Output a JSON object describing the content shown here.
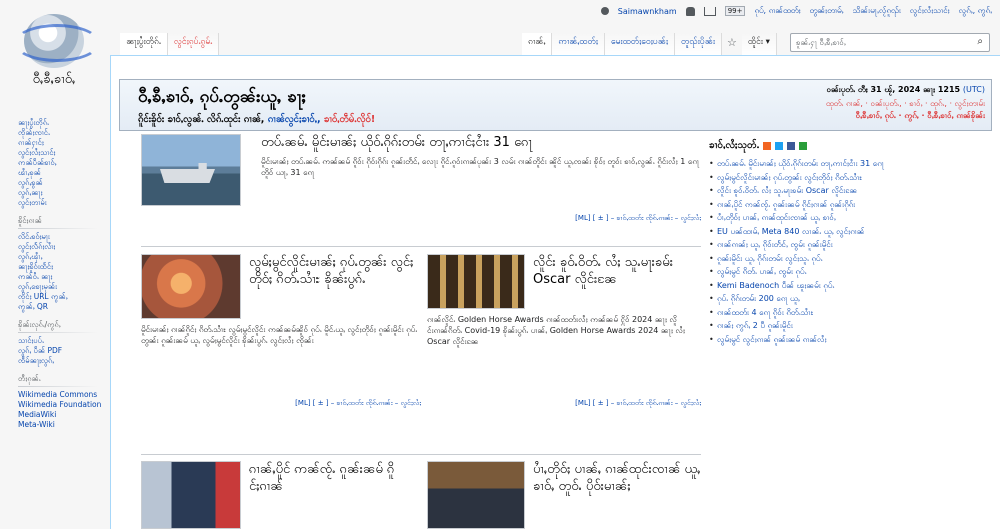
{
  "personal": {
    "username": "Saimawnkham",
    "notifications_count": "99+",
    "links": [
      "ၵုပ်, ၵၢၼ်ထတ်ႈ",
      "တွၼ်ႈတၢမ်ႇ",
      "သိၼ်းမႃႇလႂ်ၵူၺ်း",
      "လွင်ႈလႆႈသၢင်ႈ",
      "လွၵ်ႇ, ဢွၵ်ႇ"
    ]
  },
  "logo": {
    "wordmark": "ဝီႇၶီႇၶၢဝ်ႇ"
  },
  "tabs_left": [
    {
      "label": "ၼႃႈပွႆးတိုၵ်ႉ",
      "selected": true
    },
    {
      "label": "လွင်ႈၵုပ်ႉၵွမ်ႉ",
      "selected": false
    }
  ],
  "tabs_right": [
    {
      "label": "ၵၢၼ်ႇ",
      "selected": true
    },
    {
      "label": "ဢၢၼ်ႇထတ်ႈ",
      "selected": false
    },
    {
      "label": "မေးထတ်ႈဝေႈပၼ်ႈ",
      "selected": false
    },
    {
      "label": "တူၺ်းပိုၼ်း",
      "selected": false
    }
  ],
  "more_tab": "ထိူင်း ▾",
  "search": {
    "placeholder": "ၶူၼ်ႉႁႃ ဝီႇၶီႇၶၢဝ်ႇ"
  },
  "sidebar": {
    "sections": [
      {
        "head": "",
        "items": [
          "ၼႃႈပွႆးတိုၵ်ႉ",
          "ၸိုၼ်ႈၸၢင်ႉ",
          "ၵၢၼ်ႁၢင်ႈ",
          "လွင်ႈလႆႈသၢင်ႈ",
          "ဢၼ်ပဵၼ်ၶၢဝ်ႇ",
          "ၽၢႆႇၶုၼ်",
          "လွၵ်ႇၶွၼ်",
          "လွၵ်ႇၼႃႈ",
          "လွင်ႈတၢမ်း"
        ]
      },
      {
        "head": "ၶိူင်ႈၵၢၼ်",
        "items": [
          "လိင်ႉၶဝ်ႈမႃး",
          "လွင်ႈလႅၵ်ႈလၢႆႈ",
          "လွၵ်ႇၾၢႆႇ",
          "ၼႃႈၶိူဝ်းထႅင်ႈ",
          "ဢၼ်ဝႆႉ ၼႃႈ",
          "လွၵ်ႇၶေႃႈမုၼ်း",
          "ၸိုင်ႈ URL ဢွၼ်ႇ",
          "ဢွၼ်ႇ QR"
        ]
      },
      {
        "head": "ၶိုၼ်းလုၵ်ႉ/ဢွၵ်ႇ",
        "items": [
          "သၢင်ႈပပ်ႉ",
          "လွၵ်ႇ ပဵၼ် PDF",
          "ၸဵမ်ၼႃႈလွၵ်ႇ"
        ]
      },
      {
        "head": "တီႈၵုၼ်ႉ",
        "items": [
          "Wikimedia Commons",
          "Wikimedia Foundation",
          "MediaWiki",
          "Meta-Wiki"
        ]
      }
    ]
  },
  "banner": {
    "title": "ဝီႇၶီႇၶၢဝ်ႇ ၵုပ်ႉတွၼ်းယူႇ ၶႃႈ",
    "sub_a": "ၵိူင်းၶိူဝ်း ၶၢဝ်ႇလွၼ်ႉ လိၵ်ႉထုင်း ၵၢၼ်, ",
    "sub_b": "ၵၢၼ်လွင်ႈၶၢဝ်ႇ, ",
    "sub_c": "ၶၢဝ်ႇတဵမ်ႉလိုဝ်!",
    "date_prefix": "ဝၼ်းပုတ်ႉ တီႈ 31 ၽႂ်, 2024 ၼႃႈ 1215",
    "utc": "(UTC)",
    "links1": "ထုတ်ႉ ၵၢၼ်, · ဝၼ်းပုတ်ႉ, · ၶၢဝ်ႇ · ထုၵ်ႉ, · လွင်ႈတၢမ်း",
    "links2": "ဝီႇၶီႇၶၢဝ်ႇ ၵုပ်ႉ · ဢွၵ်ႇ · ဝီႇၶီႇၶၢဝ်ႇ ၵၢၼ်ၶိုၼ်း"
  },
  "articles": [
    {
      "headline": "တပ်ႉၼမ်ႉ မိူင်းမၢၼ်ႈ ယိုဝ်ႉၵိုၵ်းတမ်း တႃႇဢၢင်ႈငၢႆး 31 ၵေႃ",
      "summary": "မိူင်းမၢၼ်ႈ တပ်ႉၼမ်ႉ ဢၼ်ၼမ် ၵိူဝ်း ၵိုဝ်းၵိုၵ်း ၵူၼ်းတႅင်ႇ လေႃး ၵိူင်ႉၵူဝ်းၵၢၼ်ပုၼ်း 3 လမ်း ၵၢၼ်တိူင်း ၼိူင် ယူႇၸၼ်း ၶိုဝ်ႈ တူဝ်း ၶၢဝ်ႇလွၼ်ႉ ၵိူင်းလႆႈ 1 ၵေႃ တိူဝ် ယႃႇ 31 ၵေႃ",
      "footer": "[ML] [ ± ] – ၶၢဝ်ႇထတ်း ၸိုၵ်ႉၵၢၼ်း – လွင်ႈလႆႈ"
    },
    {
      "headline": "လွမ်ႈမွင်လိူင်းမၢၼ်ႈ ၵုပ်ႉတွၼ်း လွင်ႈတိုဝ်ႈ ၵိတ်ႉသၢႆႊ ၶိုၼ်းပွၵ်ႉ",
      "summary": "မိူင်းမၢၼ်ႈ ၵၢၼ်ၵိူင်ႈ ၵိတ်ႉသၢႆႊ လွမ်ႈမွင်လိူင်း ဢၼ်ၼမ်ၼိူဝ် ၵုပ်ႉ မိူင်ႉယူႇ လွင်ႈတိုဝ်ႈ ၵူၼ်းမိူင်း ၵုပ်ႉတွၼ်း ၵူၼ်းၼမ် ယူႇ လွမ်ႈမွင်လိူင်း ၶိုၼ်းပွၵ်ႉ လွင်ႈလႆႈ ၸိုၼ်း",
      "footer": "[ML] [ ± ] – ၶၢဝ်ႇထတ်း ၸိုၵ်ႉၵၢၼ်း – လွင်ႈလႆႈ"
    },
    {
      "headline": "လိူင်း ၶူဝ်ႉဝိတ်ႉ လႆႈ သူႉမႃးၶမ်း Oscar လိူင်းၼႄ",
      "summary": "ၵၢၼ်လိူင်ႉ Golden Horse Awards ၵၢၼ်ထတ်းလႆႈ ဢၼ်ၼမ် ႁိုဝ် 2024 ၼႃႈ လိူင်းၵၢၼ်ၵိတ်ႉ Covid-19 ၶိုၼ်းပွၵ်ႉ ပၢၼ်ႇ Golden Horse Awards 2024 ၼႃႈ လႆႈ Oscar လိူင်းၼႄ",
      "footer": "[ML] [ ± ] – ၶၢဝ်ႇထတ်း ၸိုၵ်ႉၵၢၼ်း – လွင်ႈလႆႈ"
    },
    {
      "headline": "ၵၢၼ်ႇပိူင် ဢၼ်ၸႂ်ႉ ၵူၼ်းၼမ် ၵိူင်ႈၵၢၼ်",
      "summary": "",
      "footer": ""
    },
    {
      "headline": "ပၢႆႇတိုဝ်ႈ ပၢၼ်ႇ ၵၢၼ်ထုင်းၸၢၼ် ယူႇ ၶၢဝ်ႇ တူဝ်ႉ ပိုဝ်းမၢၼ်ႈ",
      "summary": "",
      "footer": ""
    }
  ],
  "news": {
    "heading": "ၶၢဝ်ႇလႆႈသုတ်ႉ",
    "items": [
      "တပ်ႉၼမ်ႉ မိူင်းမၢၼ်ႈ ယိုဝ်ႉၵိုၵ်းတမ်း တႃႇဢၢင်ႈငၢႆး 31 ၵေႃ",
      "လွမ်ႈမွင်လိူင်းမၢၼ်ႈ ၵုပ်ႉတွၼ်း လွင်ႈတိုဝ်ႈ ၵိတ်ႉသၢႆႊ",
      "လိူင်း ၶူဝ်ႉဝိတ်ႉ လႆႈ သူႉမႃးၶမ်း Oscar လိူင်းၼႄ",
      "ၵၢၼ်ႇပိူင် ဢၼ်ၸႂ်ႉ ၵူၼ်းၼမ် ၵိူင်ႈၵၢၼ် ၵူၼ်းၵိုၵ်း",
      "ပၢႆႇတိုဝ်ႈ ပၢၼ်ႇ ၵၢၼ်ထုင်းၸၢၼ် ယူႇ ၶၢဝ်ႇ",
      "EU ပၼ်ထၢမ်ႇ Meta 840 လၢၼ်ႉ ယူႇ လွင်ႈၵၢၼ်",
      "ၵၢၼ်ၵၢၼ်ႈ ယူႇ ၵိုဝ်းတႅင်ႇ ၸွမ်း ၵူၼ်းမိူင်း",
      "ၵူၼ်းမိူင်း ယူႇ ၵိုၵ်းတမ်း လွင်ႈသူႉ ၵုပ်ႉ",
      "လွမ်ႈမွင် ၵိတ်ႉ ပၢၼ်ႇ ၸွမ်း ၵုပ်ႉ",
      "Kemi Badenoch ပဵၼ် ၽူႈၼမ်း ၵုပ်ႉ",
      "ၵုပ်ႉ ၵိုၵ်းတမ်း 200 ၵေႃ ယူႇ",
      "ၵၢၼ်ထတ်း 4 ၵေႃ ၵိူဝ်း ၵိတ်ႉသၢႆႊ",
      "ၵၢၼ်ႈ ဢွၵ်ႇ 2 ပီ ၵူၼ်းမိူင်း",
      "လွမ်ႈမွင် လွင်ႈၵၢၼ် ၵူၼ်းၼမ် ၵၢၼ်လႆႈ"
    ]
  },
  "colors": {
    "link": "#0645ad",
    "red_link": "#dd3333",
    "border": "#a7d7f9"
  }
}
